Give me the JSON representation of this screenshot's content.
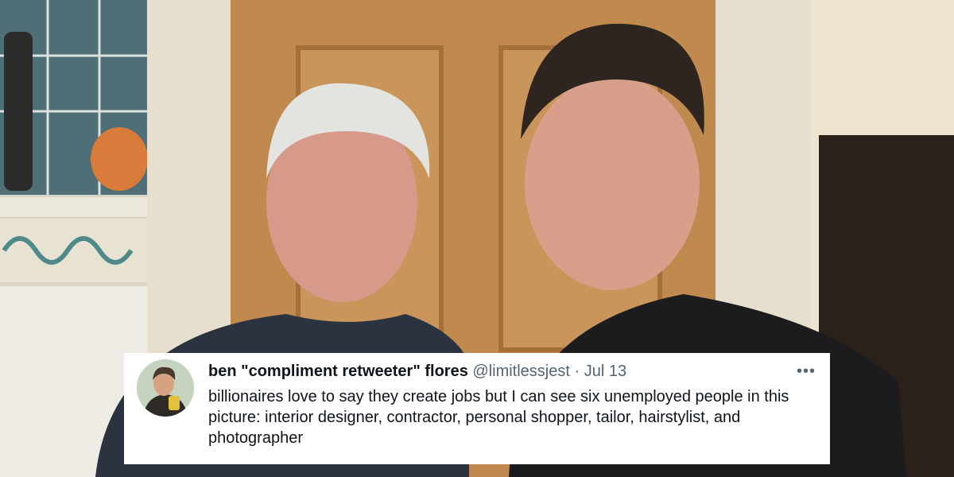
{
  "tweet": {
    "display_name": "ben \"compliment retweeter\" flores",
    "handle": "@limitlessjest",
    "separator": "·",
    "date": "Jul 13",
    "more_icon": "more-horizontal-icon",
    "more_glyph": "•••",
    "text": "billionaires love to say they create jobs but I can see six unemployed people in this picture: interior designer, contractor, personal shopper, tailor, hairstylist, and photographer"
  },
  "colors": {
    "card_bg": "#ffffff",
    "text_primary": "#0f1419",
    "text_secondary": "#536471",
    "door_wood": "#c08a4e"
  }
}
